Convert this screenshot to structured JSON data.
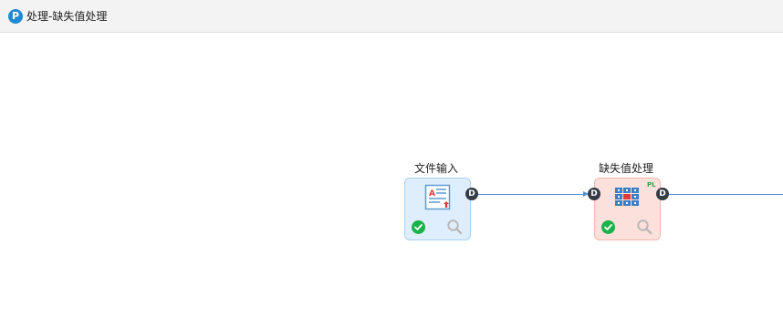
{
  "window": {
    "title": "处理-缺失值处理",
    "app_icon_letter": "P"
  },
  "nodes": [
    {
      "label": "文件输入",
      "icon": "file-input-icon",
      "status_icon": "check-circle-icon",
      "action_icon": "magnifier-icon",
      "output_port": "D"
    },
    {
      "label": "缺失值处理",
      "icon": "missing-value-grid-icon",
      "badge": "PL",
      "status_icon": "check-circle-icon",
      "action_icon": "magnifier-icon",
      "input_port": "D",
      "output_port": "D"
    }
  ],
  "colors": {
    "link": "#4a90d9",
    "status_ok": "#19b34a",
    "input_node_bg": "#dfeefc",
    "missing_node_bg": "#fbe0dc"
  }
}
